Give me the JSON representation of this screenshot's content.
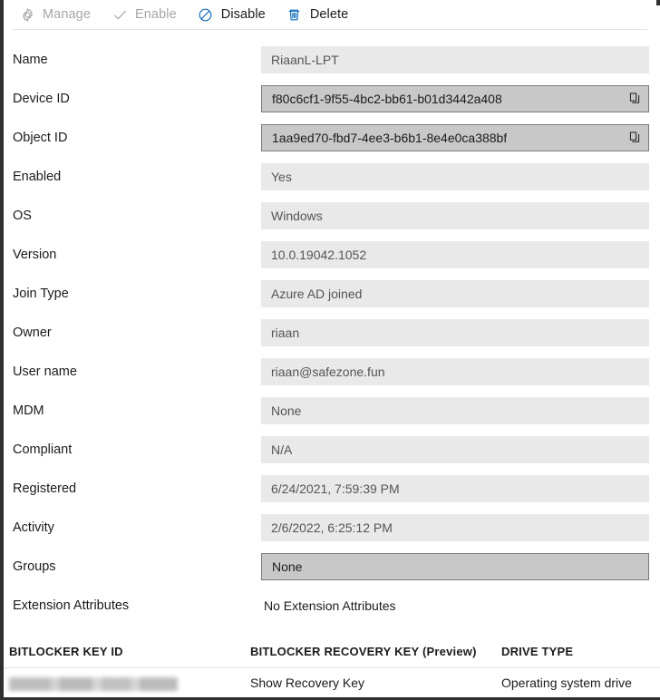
{
  "toolbar": {
    "commands": [
      {
        "label": "Manage",
        "icon": "gear-icon",
        "enabled": false
      },
      {
        "label": "Enable",
        "icon": "check-icon",
        "enabled": false
      },
      {
        "label": "Disable",
        "icon": "block-icon",
        "enabled": true
      },
      {
        "label": "Delete",
        "icon": "trash-icon",
        "enabled": true
      }
    ]
  },
  "details": {
    "rows": [
      {
        "label": "Name",
        "value": "RiaanL-LPT",
        "style": "readonly"
      },
      {
        "label": "Device ID",
        "value": "f80c6cf1-9f55-4bc2-bb61-b01d3442a408",
        "style": "copyable"
      },
      {
        "label": "Object ID",
        "value": "1aa9ed70-fbd7-4ee3-b6b1-8e4e0ca388bf",
        "style": "copyable"
      },
      {
        "label": "Enabled",
        "value": "Yes",
        "style": "readonly"
      },
      {
        "label": "OS",
        "value": "Windows",
        "style": "readonly"
      },
      {
        "label": "Version",
        "value": "10.0.19042.1052",
        "style": "readonly"
      },
      {
        "label": "Join Type",
        "value": "Azure AD joined",
        "style": "readonly"
      },
      {
        "label": "Owner",
        "value": "riaan",
        "style": "readonly"
      },
      {
        "label": "User name",
        "value": "riaan@safezone.fun",
        "style": "readonly"
      },
      {
        "label": "MDM",
        "value": "None",
        "style": "readonly"
      },
      {
        "label": "Compliant",
        "value": "N/A",
        "style": "readonly"
      },
      {
        "label": "Registered",
        "value": "6/24/2021, 7:59:39 PM",
        "style": "readonly"
      },
      {
        "label": "Activity",
        "value": "2/6/2022, 6:25:12 PM",
        "style": "readonly"
      },
      {
        "label": "Groups",
        "value": "None",
        "style": "group"
      },
      {
        "label": "Extension Attributes",
        "value": "No Extension Attributes",
        "style": "plain"
      }
    ]
  },
  "bitlocker": {
    "headers": {
      "key_id": "BITLOCKER KEY ID",
      "recovery_key": "BITLOCKER RECOVERY KEY (Preview)",
      "drive_type": "DRIVE TYPE"
    },
    "row": {
      "key_id": "",
      "recovery_key_link": "Show Recovery Key",
      "drive_type": "Operating system drive"
    }
  },
  "colors": {
    "accent_link": "#0b5cc4",
    "icon_blue": "#0f6cbd",
    "readonly_field": "#e9e9e9",
    "emphasized_field": "#c8c8c8",
    "text_primary": "#1b1b1b",
    "text_disabled": "#a6a6a6"
  }
}
